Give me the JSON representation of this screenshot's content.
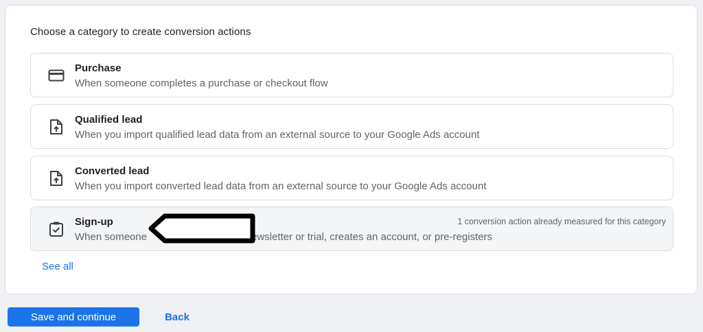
{
  "heading": "Choose a category to create conversion actions",
  "options": [
    {
      "title": "Purchase",
      "description": "When someone completes a purchase or checkout flow",
      "icon": "credit-card-icon",
      "note": ""
    },
    {
      "title": "Qualified lead",
      "description": "When you import qualified lead data from an external source to your Google Ads account",
      "icon": "file-upload-icon",
      "note": ""
    },
    {
      "title": "Converted lead",
      "description": "When you import converted lead data from an external source to your Google Ads account",
      "icon": "file-upload-icon",
      "note": ""
    },
    {
      "title": "Sign-up",
      "description": "When someone",
      "description_tail": "ewsletter or trial, creates an account, or pre-registers",
      "icon": "clipboard-check-icon",
      "note": "1 conversion action already measured for this category",
      "selected": true
    }
  ],
  "see_all_label": "See all",
  "footer": {
    "primary_label": "Save and continue",
    "secondary_label": "Back"
  },
  "colors": {
    "accent": "#1a73e8",
    "page_bg": "#eef0f3",
    "border": "#dadce0",
    "selected_bg": "#f4f5f6"
  }
}
